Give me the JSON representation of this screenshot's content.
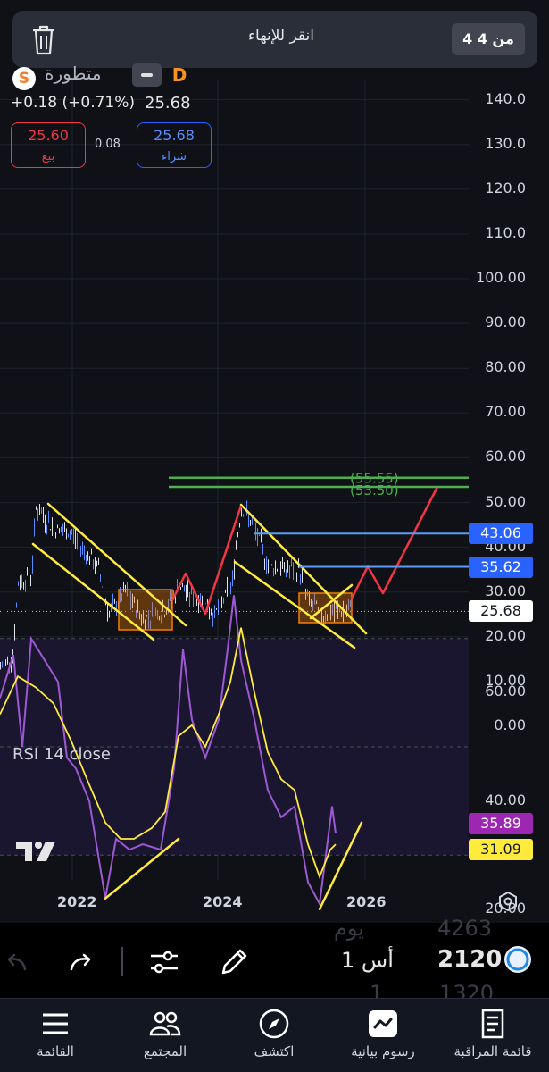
{
  "topbar": {
    "title": "انقر للإنهاء",
    "counter": "4 من 4"
  },
  "symbol": {
    "name": "متطورة",
    "logo_letter": "S",
    "interval_badge": "D",
    "change": "+0.18 (+0.71%)",
    "last_price": "25.68",
    "sell_price": "25.60",
    "sell_label": "بيع",
    "buy_price": "25.68",
    "buy_label": "شراء",
    "spread": "0.08"
  },
  "colors": {
    "sell": "#f23645",
    "buy": "#2962ff",
    "trend_yellow": "#ffeb3b",
    "projection_red": "#f23645",
    "target_green": "#4caf50",
    "level_blue": "#5b9cf6",
    "rsi_line": "#9c59d1"
  },
  "price_axis": {
    "labels": [
      "140.0",
      "130.0",
      "120.0",
      "110.0",
      "100.00",
      "90.00",
      "80.00",
      "70.00",
      "60.00",
      "50.00",
      "40.00",
      "30.00",
      "20.00",
      "10.00",
      "0.00"
    ],
    "tags": [
      {
        "value": "43.06",
        "style": "blue"
      },
      {
        "value": "35.62",
        "style": "blue"
      },
      {
        "value": "25.68",
        "style": "white"
      }
    ],
    "green_targets": [
      "55.55",
      "53.50"
    ]
  },
  "rsi": {
    "title": "RSI 14 close",
    "axis_labels": [
      "60.00",
      "40.00",
      "20.00"
    ],
    "tags": [
      {
        "value": "35.89",
        "style": "purple"
      },
      {
        "value": "31.09",
        "style": "yellow"
      }
    ]
  },
  "time_axis": {
    "years": [
      "2022",
      "2024",
      "2026"
    ]
  },
  "orderbook": {
    "rows": [
      {
        "label": "يوم",
        "value": "4263"
      },
      {
        "label": "1 أس",
        "value": "2120"
      },
      {
        "label": "1",
        "value": "1320"
      }
    ]
  },
  "bottom_nav": {
    "items": [
      {
        "label": "القائمة",
        "icon": "menu-icon"
      },
      {
        "label": "المجتمع",
        "icon": "community-icon"
      },
      {
        "label": "اكتشف",
        "icon": "compass-icon"
      },
      {
        "label": "رسوم بيانية",
        "icon": "chart-icon"
      },
      {
        "label": "قائمة المراقبة",
        "icon": "watchlist-icon"
      }
    ]
  }
}
